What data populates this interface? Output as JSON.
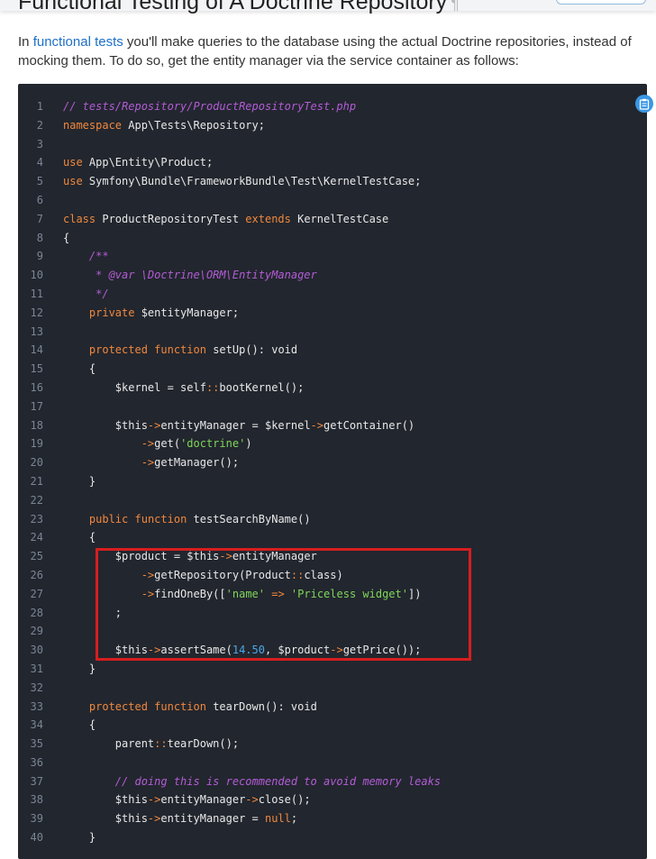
{
  "heading": {
    "text": "Functional Testing of A Doctrine Repository",
    "anchor": "¶"
  },
  "intro": {
    "prefix": "In ",
    "link": "functional tests",
    "suffix": " you'll make queries to the database using the actual Doctrine repositories, instead of mocking them. To do so, get the entity manager via the service container as follows:"
  },
  "copy_button": {
    "icon": "clipboard-icon"
  },
  "colors": {
    "code_bg": "#22262e",
    "highlight_border": "#d61e1e",
    "link": "#1e6fc7",
    "accent": "#3b97e3"
  },
  "code": {
    "lines": [
      [
        [
          "com",
          "// tests/Repository/ProductRepositoryTest.php"
        ]
      ],
      [
        [
          "kw",
          "namespace"
        ],
        [
          "txt",
          " App\\Tests\\Repository;"
        ]
      ],
      [],
      [
        [
          "kw",
          "use"
        ],
        [
          "txt",
          " App\\Entity\\Product;"
        ]
      ],
      [
        [
          "kw",
          "use"
        ],
        [
          "txt",
          " Symfony\\Bundle\\FrameworkBundle\\Test\\KernelTestCase;"
        ]
      ],
      [],
      [
        [
          "kw",
          "class"
        ],
        [
          "txt",
          " ProductRepositoryTest "
        ],
        [
          "kw",
          "extends"
        ],
        [
          "txt",
          " KernelTestCase"
        ]
      ],
      [
        [
          "txt",
          "{"
        ]
      ],
      [
        [
          "com",
          "    /**"
        ]
      ],
      [
        [
          "com",
          "     * @var \\Doctrine\\ORM\\EntityManager"
        ]
      ],
      [
        [
          "com",
          "     */"
        ]
      ],
      [
        [
          "txt",
          "    "
        ],
        [
          "kw",
          "private"
        ],
        [
          "txt",
          " $entityManager;"
        ]
      ],
      [],
      [
        [
          "txt",
          "    "
        ],
        [
          "kw",
          "protected"
        ],
        [
          "txt",
          " "
        ],
        [
          "kw",
          "function"
        ],
        [
          "txt",
          " setUp"
        ],
        [
          "txt",
          "(): "
        ],
        [
          "txt",
          "void"
        ]
      ],
      [
        [
          "txt",
          "    {"
        ]
      ],
      [
        [
          "txt",
          "        $kernel = self"
        ],
        [
          "op",
          "::"
        ],
        [
          "txt",
          "bootKernel();"
        ]
      ],
      [],
      [
        [
          "txt",
          "        $this"
        ],
        [
          "op",
          "->"
        ],
        [
          "txt",
          "entityManager = $kernel"
        ],
        [
          "op",
          "->"
        ],
        [
          "txt",
          "getContainer()"
        ]
      ],
      [
        [
          "txt",
          "            "
        ],
        [
          "op",
          "->"
        ],
        [
          "txt",
          "get("
        ],
        [
          "str",
          "'doctrine'"
        ],
        [
          "txt",
          ")"
        ]
      ],
      [
        [
          "txt",
          "            "
        ],
        [
          "op",
          "->"
        ],
        [
          "txt",
          "getManager();"
        ]
      ],
      [
        [
          "txt",
          "    }"
        ]
      ],
      [],
      [
        [
          "txt",
          "    "
        ],
        [
          "kw",
          "public"
        ],
        [
          "txt",
          " "
        ],
        [
          "kw",
          "function"
        ],
        [
          "txt",
          " testSearchByName()"
        ]
      ],
      [
        [
          "txt",
          "    {"
        ]
      ],
      [
        [
          "txt",
          "        $product = $this"
        ],
        [
          "op",
          "->"
        ],
        [
          "txt",
          "entityManager"
        ]
      ],
      [
        [
          "txt",
          "            "
        ],
        [
          "op",
          "->"
        ],
        [
          "txt",
          "getRepository(Product"
        ],
        [
          "op",
          "::"
        ],
        [
          "txt",
          "class)"
        ]
      ],
      [
        [
          "txt",
          "            "
        ],
        [
          "op",
          "->"
        ],
        [
          "txt",
          "findOneBy(["
        ],
        [
          "str",
          "'name'"
        ],
        [
          "txt",
          " "
        ],
        [
          "op",
          "=>"
        ],
        [
          "txt",
          " "
        ],
        [
          "str",
          "'Priceless widget'"
        ],
        [
          "txt",
          "])"
        ]
      ],
      [
        [
          "txt",
          "        ;"
        ]
      ],
      [],
      [
        [
          "txt",
          "        $this"
        ],
        [
          "op",
          "->"
        ],
        [
          "txt",
          "assertSame("
        ],
        [
          "num",
          "14.50"
        ],
        [
          "txt",
          ", $product"
        ],
        [
          "op",
          "->"
        ],
        [
          "txt",
          "getPrice());"
        ]
      ],
      [
        [
          "txt",
          "    }"
        ]
      ],
      [],
      [
        [
          "txt",
          "    "
        ],
        [
          "kw",
          "protected"
        ],
        [
          "txt",
          " "
        ],
        [
          "kw",
          "function"
        ],
        [
          "txt",
          " tearDown(): void"
        ]
      ],
      [
        [
          "txt",
          "    {"
        ]
      ],
      [
        [
          "txt",
          "        parent"
        ],
        [
          "op",
          "::"
        ],
        [
          "txt",
          "tearDown();"
        ]
      ],
      [],
      [
        [
          "com",
          "        // doing this is recommended to avoid memory leaks"
        ]
      ],
      [
        [
          "txt",
          "        $this"
        ],
        [
          "op",
          "->"
        ],
        [
          "txt",
          "entityManager"
        ],
        [
          "op",
          "->"
        ],
        [
          "txt",
          "close();"
        ]
      ],
      [
        [
          "txt",
          "        $this"
        ],
        [
          "op",
          "->"
        ],
        [
          "txt",
          "entityManager = "
        ],
        [
          "kw",
          "null"
        ],
        [
          "txt",
          ";"
        ]
      ],
      [
        [
          "txt",
          "    }"
        ]
      ]
    ]
  }
}
